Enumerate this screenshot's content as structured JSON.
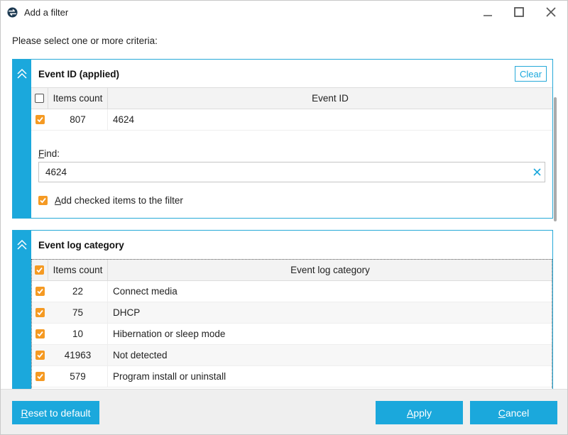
{
  "window": {
    "title": "Add a filter"
  },
  "prompt": "Please select one or more criteria:",
  "panels": [
    {
      "title": "Event ID (applied)",
      "clear_label": "Clear",
      "columns": {
        "count": "Items count",
        "name": "Event ID"
      },
      "header_checked": false,
      "rows": [
        {
          "checked": true,
          "count": "807",
          "name": "4624"
        }
      ],
      "find": {
        "label_first": "F",
        "label_rest": "ind:",
        "value": "4624"
      },
      "add_checked": {
        "checked": true,
        "label_first": "A",
        "label_rest": "dd checked items to the filter"
      }
    },
    {
      "title": "Event log category",
      "columns": {
        "count": "Items count",
        "name": "Event log category"
      },
      "header_checked": true,
      "rows": [
        {
          "checked": true,
          "count": "22",
          "name": "Connect media"
        },
        {
          "checked": true,
          "count": "75",
          "name": "DHCP"
        },
        {
          "checked": true,
          "count": "10",
          "name": "Hibernation or sleep mode"
        },
        {
          "checked": true,
          "count": "41963",
          "name": "Not detected"
        },
        {
          "checked": true,
          "count": "579",
          "name": "Program install or uninstall"
        }
      ]
    }
  ],
  "footer": {
    "reset_first": "R",
    "reset_rest": "eset to default",
    "apply_first": "A",
    "apply_rest": "pply",
    "cancel_first": "C",
    "cancel_rest": "ancel"
  },
  "colors": {
    "accent": "#1ba8dc",
    "checkbox": "#f59a23"
  }
}
